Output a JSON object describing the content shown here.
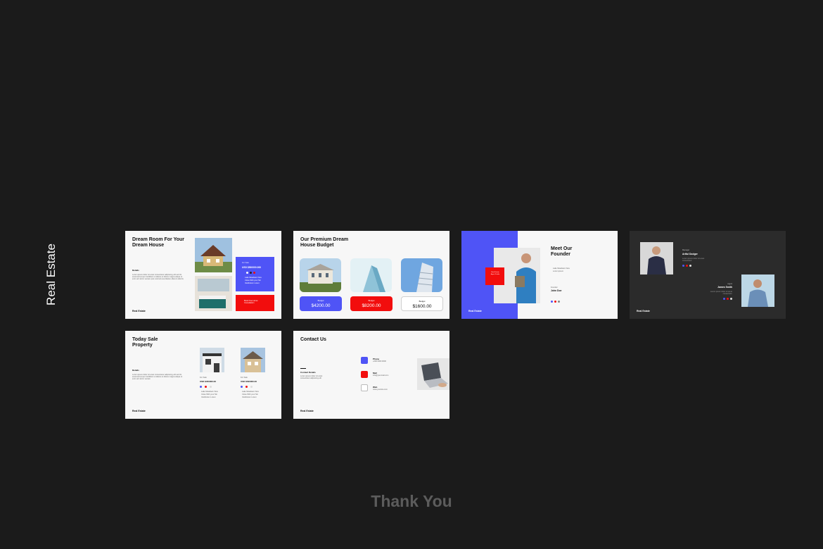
{
  "page": {
    "side_title": "Real Estate",
    "thank_you": "Thank You"
  },
  "colors": {
    "background": "#1b1b1b",
    "accent_blue": "#4f54f6",
    "accent_red": "#f20d0d",
    "slide_light": "#f7f7f7",
    "slide_dark": "#2b2b2b"
  },
  "slides": {
    "dream_room": {
      "title": "Dream Room For Your\nDream House",
      "details_label": "Details",
      "body": "Lorem ipsum dolor sit amet consectetur adipiscing elit sed do eiusmod tempor incididunt ut labore et dolore magna aliqua ut enim ad minim veniam quis nostrud exercitation ullamco laboris",
      "price_tag": "For Sale",
      "price": "USD $500000.000",
      "features": [
        "Lake Meadows View",
        "Close With your Ski",
        "Vestibulum Lorem"
      ],
      "red_text": "Book Free Home Consultation",
      "footer": "Real Estate"
    },
    "budget": {
      "title": "Our Premium Dream\nHouse Budget",
      "cards": [
        {
          "label": "Budget",
          "amount": "$4200.00"
        },
        {
          "label": "Budget",
          "amount": "$8200.00"
        },
        {
          "label": "Budget",
          "amount": "$1600.00"
        }
      ]
    },
    "founder": {
      "title": "Meet Our\nFounder",
      "red_text": "Real Estate Agent Profile",
      "list": [
        "Lake Meadows View",
        "Lorem ipsum"
      ],
      "role": "Founder",
      "name": "John Doe",
      "footer": "Real Estate"
    },
    "team": {
      "member1_role": "Manager",
      "member1_name": "Artful Dodger",
      "member1_desc": "Lorem ipsum dolor sit amet consectetur",
      "member2_role": "Agent",
      "member2_name": "James Smith",
      "member2_desc": "Lorem ipsum dolor sit amet consectetur",
      "footer": "Real Estate"
    },
    "today_sale": {
      "title": "Today Sale\nProperty",
      "details_label": "Details",
      "body": "Lorem ipsum dolor sit amet consectetur adipiscing elit sed do eiusmod tempor incididunt ut labore et dolore magna aliqua ut enim ad minim veniam",
      "prop1_tag": "For Sale",
      "prop1_price": "USD $450000.00",
      "prop1_features": [
        "Lake Meadows View",
        "Close With your Ski",
        "Vestibulum Lorem"
      ],
      "prop2_tag": "For Sale",
      "prop2_price": "USD $530000.00",
      "prop2_features": [
        "Lake Meadows View",
        "Close With your Ski",
        "Vestibulum Lorem"
      ],
      "footer": "Real Estate"
    },
    "contact": {
      "title": "Contact Us",
      "details_label": "Contact Details",
      "body": "Lorem ipsum dolor sit amet consectetur adipiscing elit",
      "phone_label": "Phone",
      "phone_value": "+000 0000 0000",
      "mail_label": "Mail",
      "mail_value": "info@yourmail.com",
      "web_label": "Web",
      "web_value": "www.yoursite.com",
      "footer": "Real Estate"
    }
  }
}
